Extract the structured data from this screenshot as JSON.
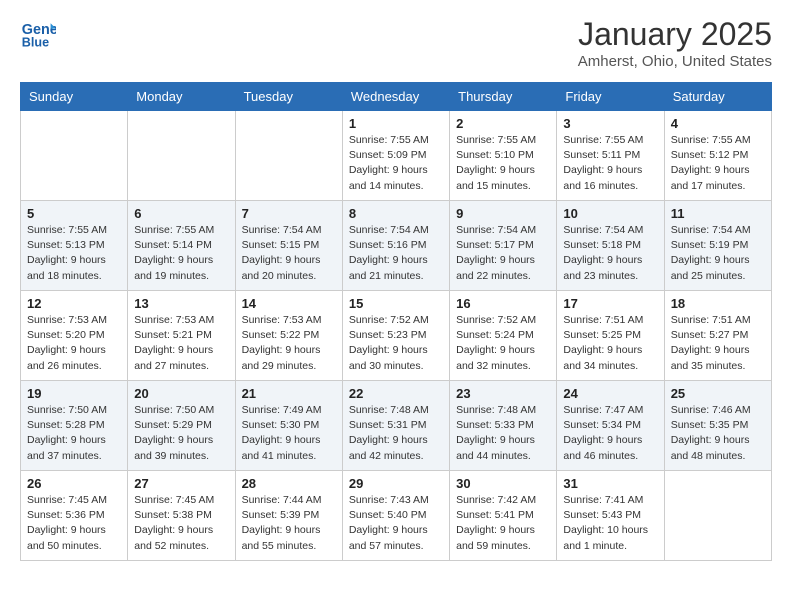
{
  "header": {
    "logo_line1": "General",
    "logo_line2": "Blue",
    "month": "January 2025",
    "location": "Amherst, Ohio, United States"
  },
  "days_of_week": [
    "Sunday",
    "Monday",
    "Tuesday",
    "Wednesday",
    "Thursday",
    "Friday",
    "Saturday"
  ],
  "weeks": [
    [
      {
        "day": "",
        "sunrise": "",
        "sunset": "",
        "daylight": ""
      },
      {
        "day": "",
        "sunrise": "",
        "sunset": "",
        "daylight": ""
      },
      {
        "day": "",
        "sunrise": "",
        "sunset": "",
        "daylight": ""
      },
      {
        "day": "1",
        "sunrise": "Sunrise: 7:55 AM",
        "sunset": "Sunset: 5:09 PM",
        "daylight": "Daylight: 9 hours and 14 minutes."
      },
      {
        "day": "2",
        "sunrise": "Sunrise: 7:55 AM",
        "sunset": "Sunset: 5:10 PM",
        "daylight": "Daylight: 9 hours and 15 minutes."
      },
      {
        "day": "3",
        "sunrise": "Sunrise: 7:55 AM",
        "sunset": "Sunset: 5:11 PM",
        "daylight": "Daylight: 9 hours and 16 minutes."
      },
      {
        "day": "4",
        "sunrise": "Sunrise: 7:55 AM",
        "sunset": "Sunset: 5:12 PM",
        "daylight": "Daylight: 9 hours and 17 minutes."
      }
    ],
    [
      {
        "day": "5",
        "sunrise": "Sunrise: 7:55 AM",
        "sunset": "Sunset: 5:13 PM",
        "daylight": "Daylight: 9 hours and 18 minutes."
      },
      {
        "day": "6",
        "sunrise": "Sunrise: 7:55 AM",
        "sunset": "Sunset: 5:14 PM",
        "daylight": "Daylight: 9 hours and 19 minutes."
      },
      {
        "day": "7",
        "sunrise": "Sunrise: 7:54 AM",
        "sunset": "Sunset: 5:15 PM",
        "daylight": "Daylight: 9 hours and 20 minutes."
      },
      {
        "day": "8",
        "sunrise": "Sunrise: 7:54 AM",
        "sunset": "Sunset: 5:16 PM",
        "daylight": "Daylight: 9 hours and 21 minutes."
      },
      {
        "day": "9",
        "sunrise": "Sunrise: 7:54 AM",
        "sunset": "Sunset: 5:17 PM",
        "daylight": "Daylight: 9 hours and 22 minutes."
      },
      {
        "day": "10",
        "sunrise": "Sunrise: 7:54 AM",
        "sunset": "Sunset: 5:18 PM",
        "daylight": "Daylight: 9 hours and 23 minutes."
      },
      {
        "day": "11",
        "sunrise": "Sunrise: 7:54 AM",
        "sunset": "Sunset: 5:19 PM",
        "daylight": "Daylight: 9 hours and 25 minutes."
      }
    ],
    [
      {
        "day": "12",
        "sunrise": "Sunrise: 7:53 AM",
        "sunset": "Sunset: 5:20 PM",
        "daylight": "Daylight: 9 hours and 26 minutes."
      },
      {
        "day": "13",
        "sunrise": "Sunrise: 7:53 AM",
        "sunset": "Sunset: 5:21 PM",
        "daylight": "Daylight: 9 hours and 27 minutes."
      },
      {
        "day": "14",
        "sunrise": "Sunrise: 7:53 AM",
        "sunset": "Sunset: 5:22 PM",
        "daylight": "Daylight: 9 hours and 29 minutes."
      },
      {
        "day": "15",
        "sunrise": "Sunrise: 7:52 AM",
        "sunset": "Sunset: 5:23 PM",
        "daylight": "Daylight: 9 hours and 30 minutes."
      },
      {
        "day": "16",
        "sunrise": "Sunrise: 7:52 AM",
        "sunset": "Sunset: 5:24 PM",
        "daylight": "Daylight: 9 hours and 32 minutes."
      },
      {
        "day": "17",
        "sunrise": "Sunrise: 7:51 AM",
        "sunset": "Sunset: 5:25 PM",
        "daylight": "Daylight: 9 hours and 34 minutes."
      },
      {
        "day": "18",
        "sunrise": "Sunrise: 7:51 AM",
        "sunset": "Sunset: 5:27 PM",
        "daylight": "Daylight: 9 hours and 35 minutes."
      }
    ],
    [
      {
        "day": "19",
        "sunrise": "Sunrise: 7:50 AM",
        "sunset": "Sunset: 5:28 PM",
        "daylight": "Daylight: 9 hours and 37 minutes."
      },
      {
        "day": "20",
        "sunrise": "Sunrise: 7:50 AM",
        "sunset": "Sunset: 5:29 PM",
        "daylight": "Daylight: 9 hours and 39 minutes."
      },
      {
        "day": "21",
        "sunrise": "Sunrise: 7:49 AM",
        "sunset": "Sunset: 5:30 PM",
        "daylight": "Daylight: 9 hours and 41 minutes."
      },
      {
        "day": "22",
        "sunrise": "Sunrise: 7:48 AM",
        "sunset": "Sunset: 5:31 PM",
        "daylight": "Daylight: 9 hours and 42 minutes."
      },
      {
        "day": "23",
        "sunrise": "Sunrise: 7:48 AM",
        "sunset": "Sunset: 5:33 PM",
        "daylight": "Daylight: 9 hours and 44 minutes."
      },
      {
        "day": "24",
        "sunrise": "Sunrise: 7:47 AM",
        "sunset": "Sunset: 5:34 PM",
        "daylight": "Daylight: 9 hours and 46 minutes."
      },
      {
        "day": "25",
        "sunrise": "Sunrise: 7:46 AM",
        "sunset": "Sunset: 5:35 PM",
        "daylight": "Daylight: 9 hours and 48 minutes."
      }
    ],
    [
      {
        "day": "26",
        "sunrise": "Sunrise: 7:45 AM",
        "sunset": "Sunset: 5:36 PM",
        "daylight": "Daylight: 9 hours and 50 minutes."
      },
      {
        "day": "27",
        "sunrise": "Sunrise: 7:45 AM",
        "sunset": "Sunset: 5:38 PM",
        "daylight": "Daylight: 9 hours and 52 minutes."
      },
      {
        "day": "28",
        "sunrise": "Sunrise: 7:44 AM",
        "sunset": "Sunset: 5:39 PM",
        "daylight": "Daylight: 9 hours and 55 minutes."
      },
      {
        "day": "29",
        "sunrise": "Sunrise: 7:43 AM",
        "sunset": "Sunset: 5:40 PM",
        "daylight": "Daylight: 9 hours and 57 minutes."
      },
      {
        "day": "30",
        "sunrise": "Sunrise: 7:42 AM",
        "sunset": "Sunset: 5:41 PM",
        "daylight": "Daylight: 9 hours and 59 minutes."
      },
      {
        "day": "31",
        "sunrise": "Sunrise: 7:41 AM",
        "sunset": "Sunset: 5:43 PM",
        "daylight": "Daylight: 10 hours and 1 minute."
      },
      {
        "day": "",
        "sunrise": "",
        "sunset": "",
        "daylight": ""
      }
    ]
  ]
}
